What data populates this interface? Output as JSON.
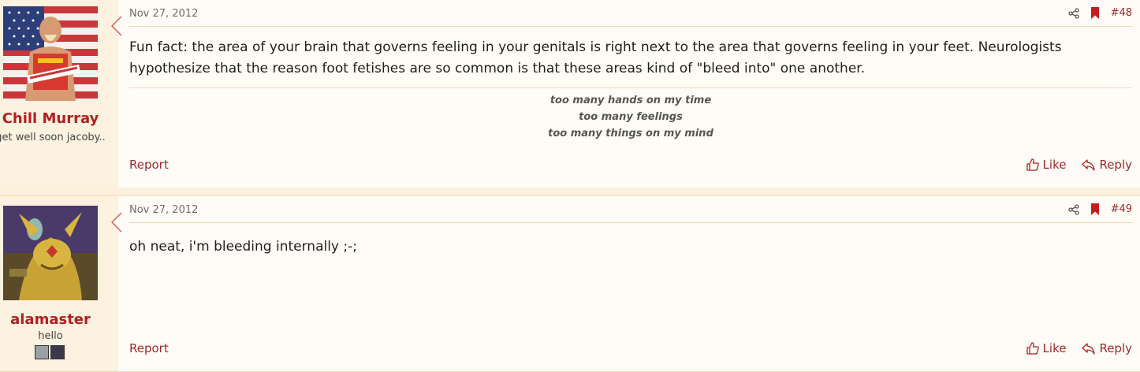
{
  "posts": [
    {
      "username": "Chill Murray",
      "user_title": "get well soon jacoby..",
      "date": "Nov 27, 2012",
      "post_number": "#48",
      "body": "Fun fact: the area of your brain that governs feeling in your genitals is right next to the area that governs feeling in your feet. Neurologists hypothesize that the reason foot fetishes are so common is that these areas kind of \"bleed into\" one another.",
      "signature": [
        "too many hands on my time",
        "too many feelings",
        "too many things on my mind"
      ],
      "report_label": "Report",
      "like_label": "Like",
      "reply_label": "Reply"
    },
    {
      "username": "alamaster",
      "user_title": "hello",
      "date": "Nov 27, 2012",
      "post_number": "#49",
      "body": "oh neat, i'm bleeding internally ;-;",
      "report_label": "Report",
      "like_label": "Like",
      "reply_label": "Reply"
    }
  ],
  "colors": {
    "accent": "#b02020",
    "user_column_bg": "#fdf1e0",
    "post_bg": "#fffcf7",
    "border": "#f1d9a9"
  }
}
